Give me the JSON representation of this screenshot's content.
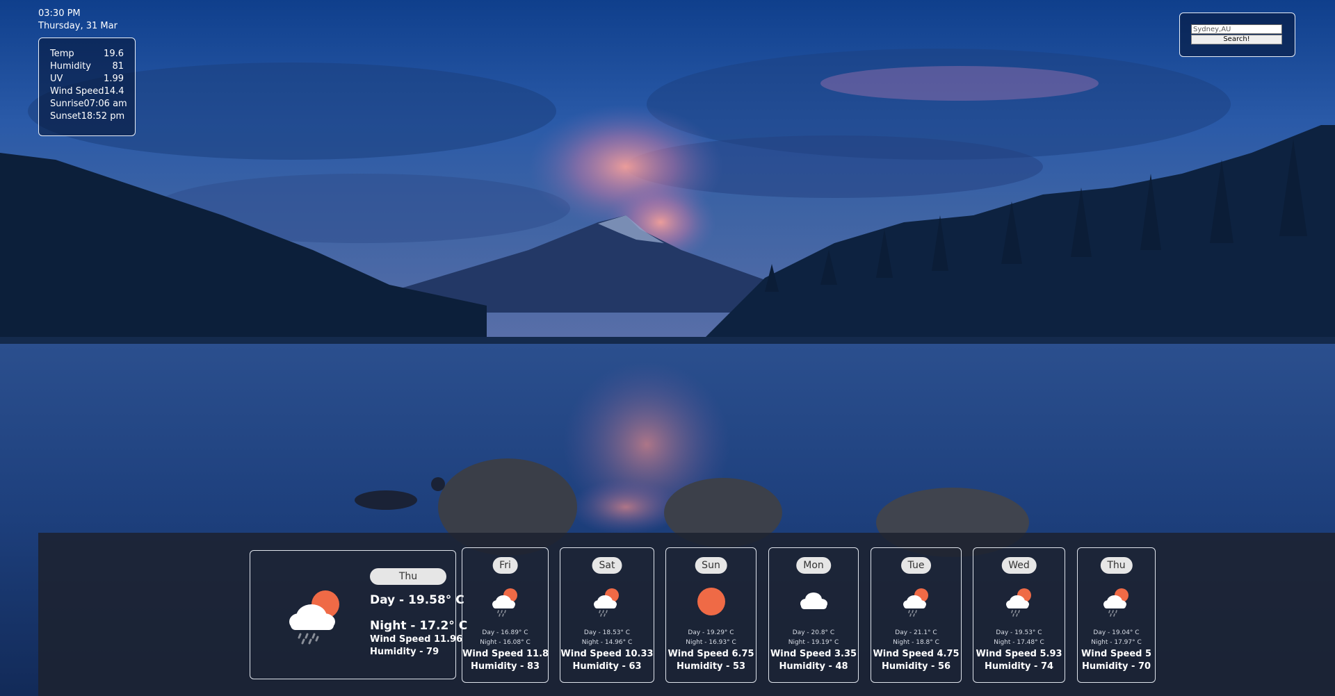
{
  "clock": {
    "time": "03:30 PM",
    "date": "Thursday, 31 Mar"
  },
  "current": [
    {
      "label": "Temp",
      "value": "19.6"
    },
    {
      "label": "Humidity",
      "value": "81"
    },
    {
      "label": "UV",
      "value": "1.99"
    },
    {
      "label": "Wind Speed",
      "value": "14.4"
    },
    {
      "label": "Sunrise",
      "value": "07:06 am"
    },
    {
      "label": "Sunset",
      "value": "18:52 pm"
    }
  ],
  "search": {
    "value": "Sydney,AU",
    "button_label": "Search!"
  },
  "today": {
    "day": "Thu",
    "icon": "sun-cloud-rain-icon",
    "day_temp": "Day - 19.58° C",
    "night_temp": "Night - 17.2° C",
    "wind": "Wind Speed 11.96",
    "humidity": "Humidity - 79"
  },
  "forecast": [
    {
      "day": "Fri",
      "icon": "sun-cloud-rain-icon",
      "day_temp": "Day - 16.89° C",
      "night_temp": "Night - 16.08° C",
      "wind": "Wind Speed 11.8",
      "humidity": "Humidity - 83"
    },
    {
      "day": "Sat",
      "icon": "sun-cloud-rain-icon",
      "day_temp": "Day - 18.53° C",
      "night_temp": "Night - 14.96° C",
      "wind": "Wind Speed 10.33",
      "humidity": "Humidity - 63"
    },
    {
      "day": "Sun",
      "icon": "sun-icon",
      "day_temp": "Day - 19.29° C",
      "night_temp": "Night - 16.93° C",
      "wind": "Wind Speed 6.75",
      "humidity": "Humidity - 53"
    },
    {
      "day": "Mon",
      "icon": "cloud-icon",
      "day_temp": "Day - 20.8° C",
      "night_temp": "Night - 19.19° C",
      "wind": "Wind Speed 3.35",
      "humidity": "Humidity - 48"
    },
    {
      "day": "Tue",
      "icon": "sun-cloud-rain-icon",
      "day_temp": "Day - 21.1° C",
      "night_temp": "Night - 18.8° C",
      "wind": "Wind Speed 4.75",
      "humidity": "Humidity - 56"
    },
    {
      "day": "Wed",
      "icon": "sun-cloud-rain-icon",
      "day_temp": "Day - 19.53° C",
      "night_temp": "Night - 17.48° C",
      "wind": "Wind Speed 5.93",
      "humidity": "Humidity - 74"
    },
    {
      "day": "Thu",
      "icon": "sun-cloud-rain-icon",
      "day_temp": "Day - 19.04° C",
      "night_temp": "Night - 17.97° C",
      "wind": "Wind Speed 5",
      "humidity": "Humidity - 70"
    }
  ],
  "colors": {
    "sun": "#ef6a46",
    "cloud": "#ffffff",
    "rain": "#8a8f99",
    "panel": "#1c2230"
  }
}
